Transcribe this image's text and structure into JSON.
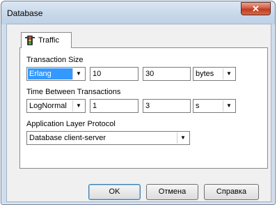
{
  "window": {
    "title": "Database",
    "close_icon": "close-icon"
  },
  "tabs": [
    {
      "label": "Traffic",
      "icon": "traffic-light-icon"
    }
  ],
  "transaction_size": {
    "label": "Transaction Size",
    "distribution": "Erlang",
    "param1": "10",
    "param2": "30",
    "unit": "bytes"
  },
  "time_between": {
    "label": "Time Between Transactions",
    "distribution": "LogNormal",
    "param1": "1",
    "param2": "3",
    "unit": "s"
  },
  "protocol": {
    "label": "Application Layer Protocol",
    "value": "Database client-server"
  },
  "buttons": {
    "ok": "OK",
    "cancel": "Отмена",
    "help": "Справка"
  },
  "colors": {
    "selection": "#3399ff",
    "close_button": "#c0391f",
    "frame": "#cfdceb"
  }
}
